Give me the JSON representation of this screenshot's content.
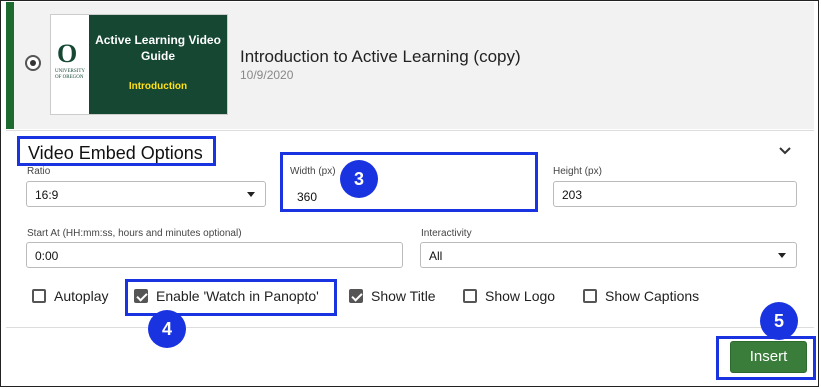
{
  "video": {
    "title": "Introduction to Active Learning (copy)",
    "date": "10/9/2020",
    "selected": true,
    "thumbnail": {
      "logo_letter": "O",
      "logo_text": "UNIVERSITY OF OREGON",
      "title": "Active Learning Video Guide",
      "subtitle": "Introduction",
      "colors": {
        "green": "#154733",
        "yellow": "#fee11a"
      }
    }
  },
  "embed_options": {
    "section_title": "Video Embed Options",
    "ratio": {
      "label": "Ratio",
      "value": "16:9"
    },
    "width": {
      "label": "Width (px)",
      "value": "360"
    },
    "height": {
      "label": "Height (px)",
      "value": "203"
    },
    "start_at": {
      "label": "Start At (HH:mm:ss, hours and minutes optional)",
      "value": "0:00"
    },
    "interactivity": {
      "label": "Interactivity",
      "value": "All"
    },
    "checkboxes": [
      {
        "label": "Autoplay",
        "checked": false
      },
      {
        "label": "Enable 'Watch in Panopto'",
        "checked": true
      },
      {
        "label": "Show Title",
        "checked": true
      },
      {
        "label": "Show Logo",
        "checked": false
      },
      {
        "label": "Show Captions",
        "checked": false
      }
    ]
  },
  "annotations": {
    "step3": "3",
    "step4": "4",
    "step5": "5",
    "highlight_color": "#1a33e0"
  },
  "footer": {
    "insert_label": "Insert"
  }
}
